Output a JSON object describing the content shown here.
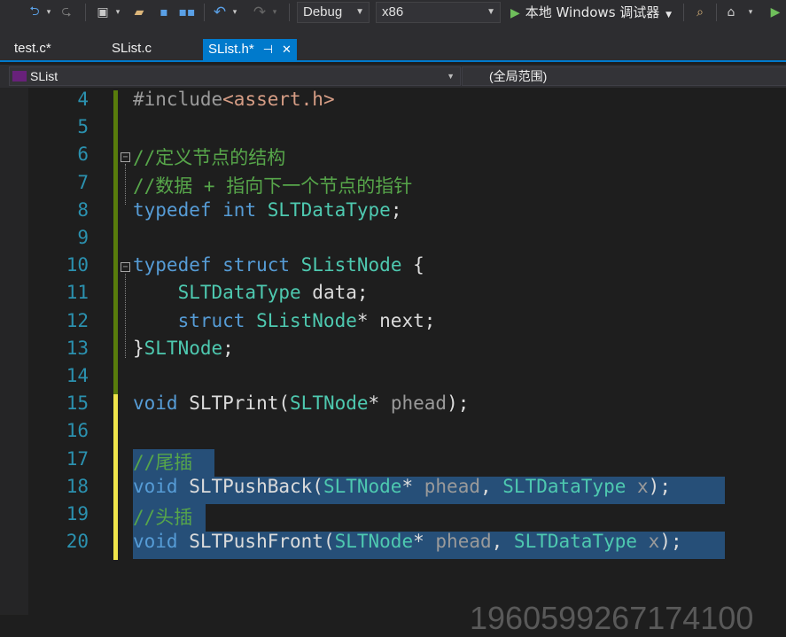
{
  "toolbar": {
    "config": "Debug",
    "platform": "x86",
    "run_label": "本地 Windows 调试器"
  },
  "tabs": [
    {
      "label": "test.c*"
    },
    {
      "label": "SList.c"
    },
    {
      "label": "SList.h*"
    }
  ],
  "nav": {
    "scope_left": "SList",
    "scope_right": "(全局范围)"
  },
  "editor": {
    "lines": [
      {
        "num": "4",
        "parts": [
          {
            "t": "#include",
            "c": "pp"
          },
          {
            "t": "<assert.h>",
            "c": "str"
          }
        ]
      },
      {
        "num": "5",
        "parts": []
      },
      {
        "num": "6",
        "parts": [
          {
            "t": "//定义节点的结构",
            "c": "cm"
          }
        ]
      },
      {
        "num": "7",
        "parts": [
          {
            "t": "//数据 + 指向下一个节点的指针",
            "c": "cm"
          }
        ]
      },
      {
        "num": "8",
        "parts": [
          {
            "t": "typedef ",
            "c": "kw"
          },
          {
            "t": "int ",
            "c": "kw"
          },
          {
            "t": "SLTDataType",
            "c": "ty"
          },
          {
            "t": ";",
            "c": ""
          }
        ]
      },
      {
        "num": "9",
        "parts": []
      },
      {
        "num": "10",
        "parts": [
          {
            "t": "typedef ",
            "c": "kw"
          },
          {
            "t": "struct ",
            "c": "kw"
          },
          {
            "t": "SListNode",
            "c": "ty"
          },
          {
            "t": " {",
            "c": ""
          }
        ]
      },
      {
        "num": "11",
        "parts": [
          {
            "t": "    SLTDataType",
            "c": "ty"
          },
          {
            "t": " data;",
            "c": ""
          }
        ]
      },
      {
        "num": "12",
        "parts": [
          {
            "t": "    struct ",
            "c": "kw"
          },
          {
            "t": "SListNode",
            "c": "ty"
          },
          {
            "t": "* next;",
            "c": ""
          }
        ]
      },
      {
        "num": "13",
        "parts": [
          {
            "t": "}",
            "c": ""
          },
          {
            "t": "SLTNode",
            "c": "ty"
          },
          {
            "t": ";",
            "c": ""
          }
        ]
      },
      {
        "num": "14",
        "parts": []
      },
      {
        "num": "15",
        "parts": [
          {
            "t": "void ",
            "c": "kw"
          },
          {
            "t": "SLTPrint",
            "c": ""
          },
          {
            "t": "(",
            "c": ""
          },
          {
            "t": "SLTNode",
            "c": "ty"
          },
          {
            "t": "* ",
            "c": ""
          },
          {
            "t": "phead",
            "c": "pr"
          },
          {
            "t": ");",
            "c": ""
          }
        ]
      },
      {
        "num": "16",
        "parts": []
      },
      {
        "num": "17",
        "parts": [
          {
            "t": "//尾插",
            "c": "cm"
          }
        ]
      },
      {
        "num": "18",
        "parts": [
          {
            "t": "void ",
            "c": "kw"
          },
          {
            "t": "SLTPushBack",
            "c": ""
          },
          {
            "t": "(",
            "c": ""
          },
          {
            "t": "SLTNode",
            "c": "ty"
          },
          {
            "t": "* ",
            "c": ""
          },
          {
            "t": "phead",
            "c": "pr"
          },
          {
            "t": ", ",
            "c": ""
          },
          {
            "t": "SLTDataType",
            "c": "ty"
          },
          {
            "t": " ",
            "c": ""
          },
          {
            "t": "x",
            "c": "pr"
          },
          {
            "t": ");",
            "c": ""
          }
        ]
      },
      {
        "num": "19",
        "parts": [
          {
            "t": "//头插",
            "c": "cm"
          }
        ]
      },
      {
        "num": "20",
        "parts": [
          {
            "t": "void ",
            "c": "kw"
          },
          {
            "t": "SLTPushFront",
            "c": ""
          },
          {
            "t": "(",
            "c": ""
          },
          {
            "t": "SLTNode",
            "c": "ty"
          },
          {
            "t": "* ",
            "c": ""
          },
          {
            "t": "phead",
            "c": "pr"
          },
          {
            "t": ", ",
            "c": ""
          },
          {
            "t": "SLTDataType",
            "c": "ty"
          },
          {
            "t": " ",
            "c": ""
          },
          {
            "t": "x",
            "c": "pr"
          },
          {
            "t": ");",
            "c": ""
          }
        ]
      }
    ]
  },
  "watermark": "1960599267174100",
  "colors": {
    "accent": "#007acc",
    "selection": "#264f78",
    "keyword": "#569cd6",
    "type": "#4ec9b0",
    "comment": "#57a64a"
  }
}
